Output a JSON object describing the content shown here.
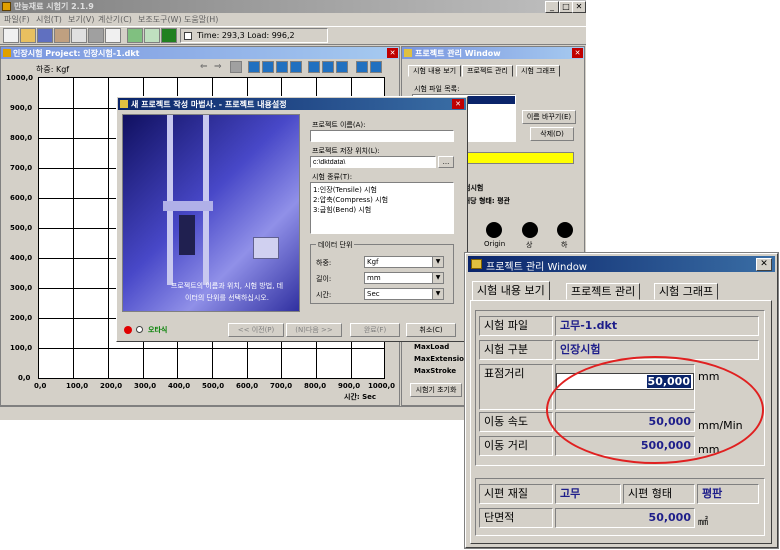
{
  "app": {
    "title": "만능재료 시험기 2.1.9",
    "menu": [
      "파일(F)",
      "시험(T)",
      "보기(V)",
      "계산기(C)",
      "보조도구(W)",
      "도움말(H)"
    ],
    "status": "Time: 293,3  Load: 996,2"
  },
  "graph_window": {
    "title": "인장시험 Project: 인장시험-1.dkt",
    "y_label": "하중: Kgf",
    "y_ticks": [
      "1000,0",
      "900,0",
      "800,0",
      "700,0",
      "600,0",
      "500,0",
      "400,0",
      "300,0",
      "200,0",
      "100,0",
      "0,0"
    ],
    "x_ticks": [
      "0,0",
      "100,0",
      "200,0",
      "300,0",
      "400,0",
      "500,0",
      "600,0",
      "700,0",
      "800,0",
      "900,0",
      "1000,0"
    ],
    "x_label": "시간: Sec"
  },
  "wizard": {
    "title": "새 프로젝트 작성 마법사. - 프로젝트 내용설정",
    "project_name_label": "프로젝트 이름(A):",
    "project_name_value": "",
    "save_path_label": "프로젝트 저장 위치(L):",
    "save_path_value": "c:\\dktdata\\",
    "browse_label": "...",
    "test_type_label": "시험 종류(T):",
    "test_types": [
      "1:인장(Tensile) 시험",
      "2:압축(Compress) 시험",
      "3:굽힘(Bend) 시험"
    ],
    "units_group": "데이터 단위",
    "units": [
      {
        "label": "하중:",
        "value": "Kgf"
      },
      {
        "label": "길이:",
        "value": "mm"
      },
      {
        "label": "시간:",
        "value": "Sec"
      }
    ],
    "hint": "프로젝트의 이름과 위치, 시험 방법, 데이터의 단위를 선택하십시오.",
    "online_label": "오타식",
    "buttons": {
      "prev": "<< 이전(P)",
      "next": "(N)다음 >>",
      "finish": "완료(F)",
      "cancel": "취소(C)"
    }
  },
  "project_panel": {
    "title": "프로젝트 관리 Window",
    "tabs": [
      "시험 내용 보기",
      "프로젝트 관리",
      "시험 그래프"
    ],
    "file_list_label": "시험 파일 목록:",
    "rename_btn": "이름 바꾸기(E)",
    "delete_btn": "삭제(D)",
    "test_row": "험시험",
    "info_row": "도: 패당   형태: 평관",
    "jog_labels": [
      "Origin",
      "상",
      "하"
    ],
    "readouts": [
      "MaxLoad",
      "MaxExtensio",
      "MaxStroke"
    ],
    "reset_btn": "시험기 초기화"
  },
  "zoom_window": {
    "title": "프로젝트 관리 Window",
    "tabs": [
      "시험 내용 보기",
      "프로젝트 관리",
      "시험 그래프"
    ],
    "file_label": "시험 파일",
    "file_value": "고무-1.dkt",
    "kind_label": "시험 구분",
    "kind_value": "인장시험",
    "gauge_label": "표점거리",
    "gauge_value": "50,000",
    "gauge_unit": "mm",
    "speed_label": "이동 속도",
    "speed_value": "50,000",
    "speed_unit": "mm/Min",
    "dist_label": "이동 거리",
    "dist_value": "500,000",
    "dist_unit": "mm",
    "material_label": "시편 재질",
    "material_value": "고무",
    "shape_label": "시편 형태",
    "shape_value": "평판",
    "area_label": "단면적",
    "area_value": "50,000",
    "area_unit": "㎟"
  }
}
